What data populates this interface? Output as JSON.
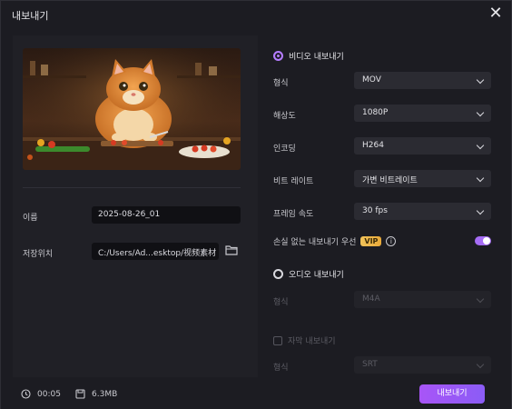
{
  "window": {
    "title": "내보내기"
  },
  "preview": {
    "alt": "Orange cat chef cutting vegetables in a kitchen"
  },
  "left": {
    "name_label": "이름",
    "name_value": "2025-08-26_01",
    "location_label": "저장위치",
    "location_value": "C:/Users/Ad...esktop/视频素材"
  },
  "video": {
    "header": "비디오 내보내기",
    "rows": [
      {
        "label": "형식",
        "value": "MOV"
      },
      {
        "label": "해상도",
        "value": "1080P"
      },
      {
        "label": "인코딩",
        "value": "H264"
      },
      {
        "label": "비트 레이트",
        "value": "가변 비트레이트"
      },
      {
        "label": "프레임 속도",
        "value": "30  fps"
      }
    ],
    "lossless_label": "손실 없는 내보내기 우선",
    "vip_badge": "VIP",
    "lossless_enabled": true
  },
  "audio": {
    "header": "오디오 내보내기",
    "format_label": "형식",
    "format_value": "M4A"
  },
  "subtitle": {
    "header": "자막 내보내기",
    "format_label": "형식",
    "format_value": "SRT"
  },
  "footer": {
    "duration": "00:05",
    "size": "6.3MB",
    "export_button": "내보내기"
  },
  "colors": {
    "accent": "#a56cf5",
    "vip": "#f1c35a",
    "bg": "#1c1c22"
  }
}
